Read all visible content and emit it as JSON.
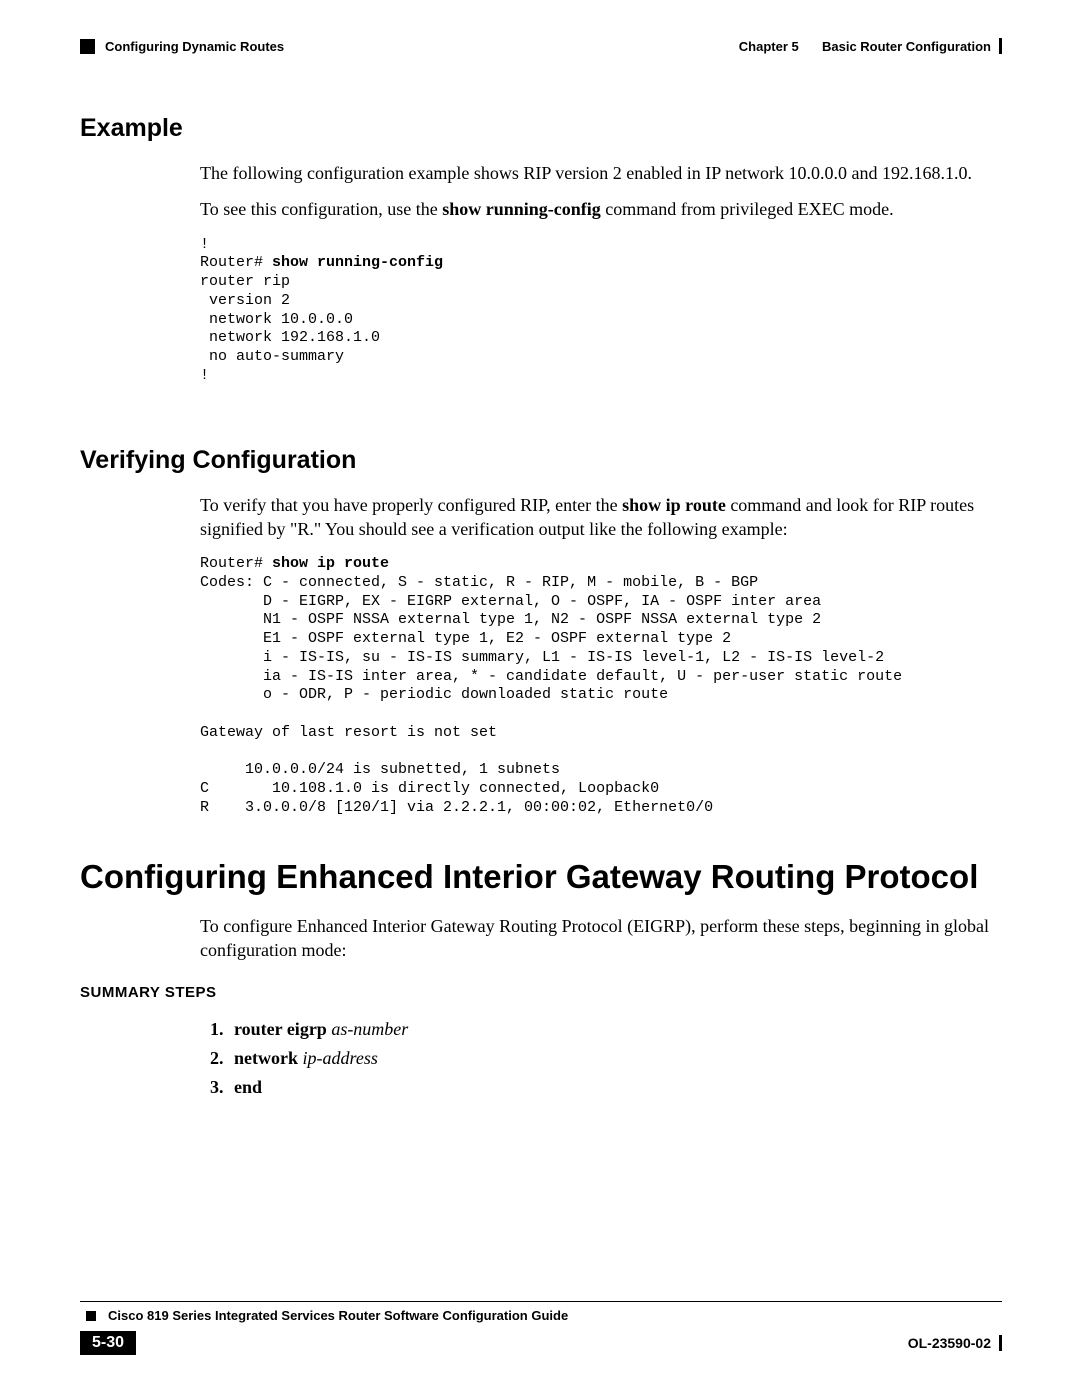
{
  "header": {
    "section_left": "Configuring Dynamic Routes",
    "chapter_label": "Chapter 5",
    "chapter_title": "Basic Router Configuration"
  },
  "s1": {
    "heading": "Example",
    "p1": "The following configuration example shows RIP version 2 enabled in IP network 10.0.0.0 and 192.168.1.0.",
    "p2a": "To see this configuration, use the ",
    "p2b": "show running-config",
    "p2c": " command from privileged EXEC mode.",
    "code_prompt": "Router# ",
    "code_cmd": "show running-config",
    "code_body": "router rip\n version 2\n network 10.0.0.0\n network 192.168.1.0\n no auto-summary\n!"
  },
  "s2": {
    "heading": "Verifying Configuration",
    "p1a": "To verify that you have properly configured RIP, enter the ",
    "p1b": "show ip route",
    "p1c": " command and look for RIP routes signified by \"R.\" You should see a verification output like the following example:",
    "code_prompt": "Router# ",
    "code_cmd": "show ip route",
    "code_body": "Codes: C - connected, S - static, R - RIP, M - mobile, B - BGP\n       D - EIGRP, EX - EIGRP external, O - OSPF, IA - OSPF inter area\n       N1 - OSPF NSSA external type 1, N2 - OSPF NSSA external type 2\n       E1 - OSPF external type 1, E2 - OSPF external type 2\n       i - IS-IS, su - IS-IS summary, L1 - IS-IS level-1, L2 - IS-IS level-2\n       ia - IS-IS inter area, * - candidate default, U - per-user static route\n       o - ODR, P - periodic downloaded static route\n\nGateway of last resort is not set\n\n     10.0.0.0/24 is subnetted, 1 subnets\nC       10.108.1.0 is directly connected, Loopback0\nR    3.0.0.0/8 [120/1] via 2.2.2.1, 00:00:02, Ethernet0/0"
  },
  "s3": {
    "heading": "Configuring Enhanced Interior Gateway Routing Protocol",
    "p1": "To configure Enhanced Interior Gateway Routing Protocol (EIGRP), perform these steps, beginning in global configuration mode:",
    "summary_label": "SUMMARY STEPS",
    "steps": [
      {
        "cmd": "router eigrp",
        "arg": "as-number"
      },
      {
        "cmd": "network",
        "arg": "ip-address"
      },
      {
        "cmd": "end",
        "arg": ""
      }
    ]
  },
  "footer": {
    "guide_title": "Cisco 819 Series Integrated Services Router Software Configuration Guide",
    "page_num": "5-30",
    "doc_id": "OL-23590-02"
  }
}
